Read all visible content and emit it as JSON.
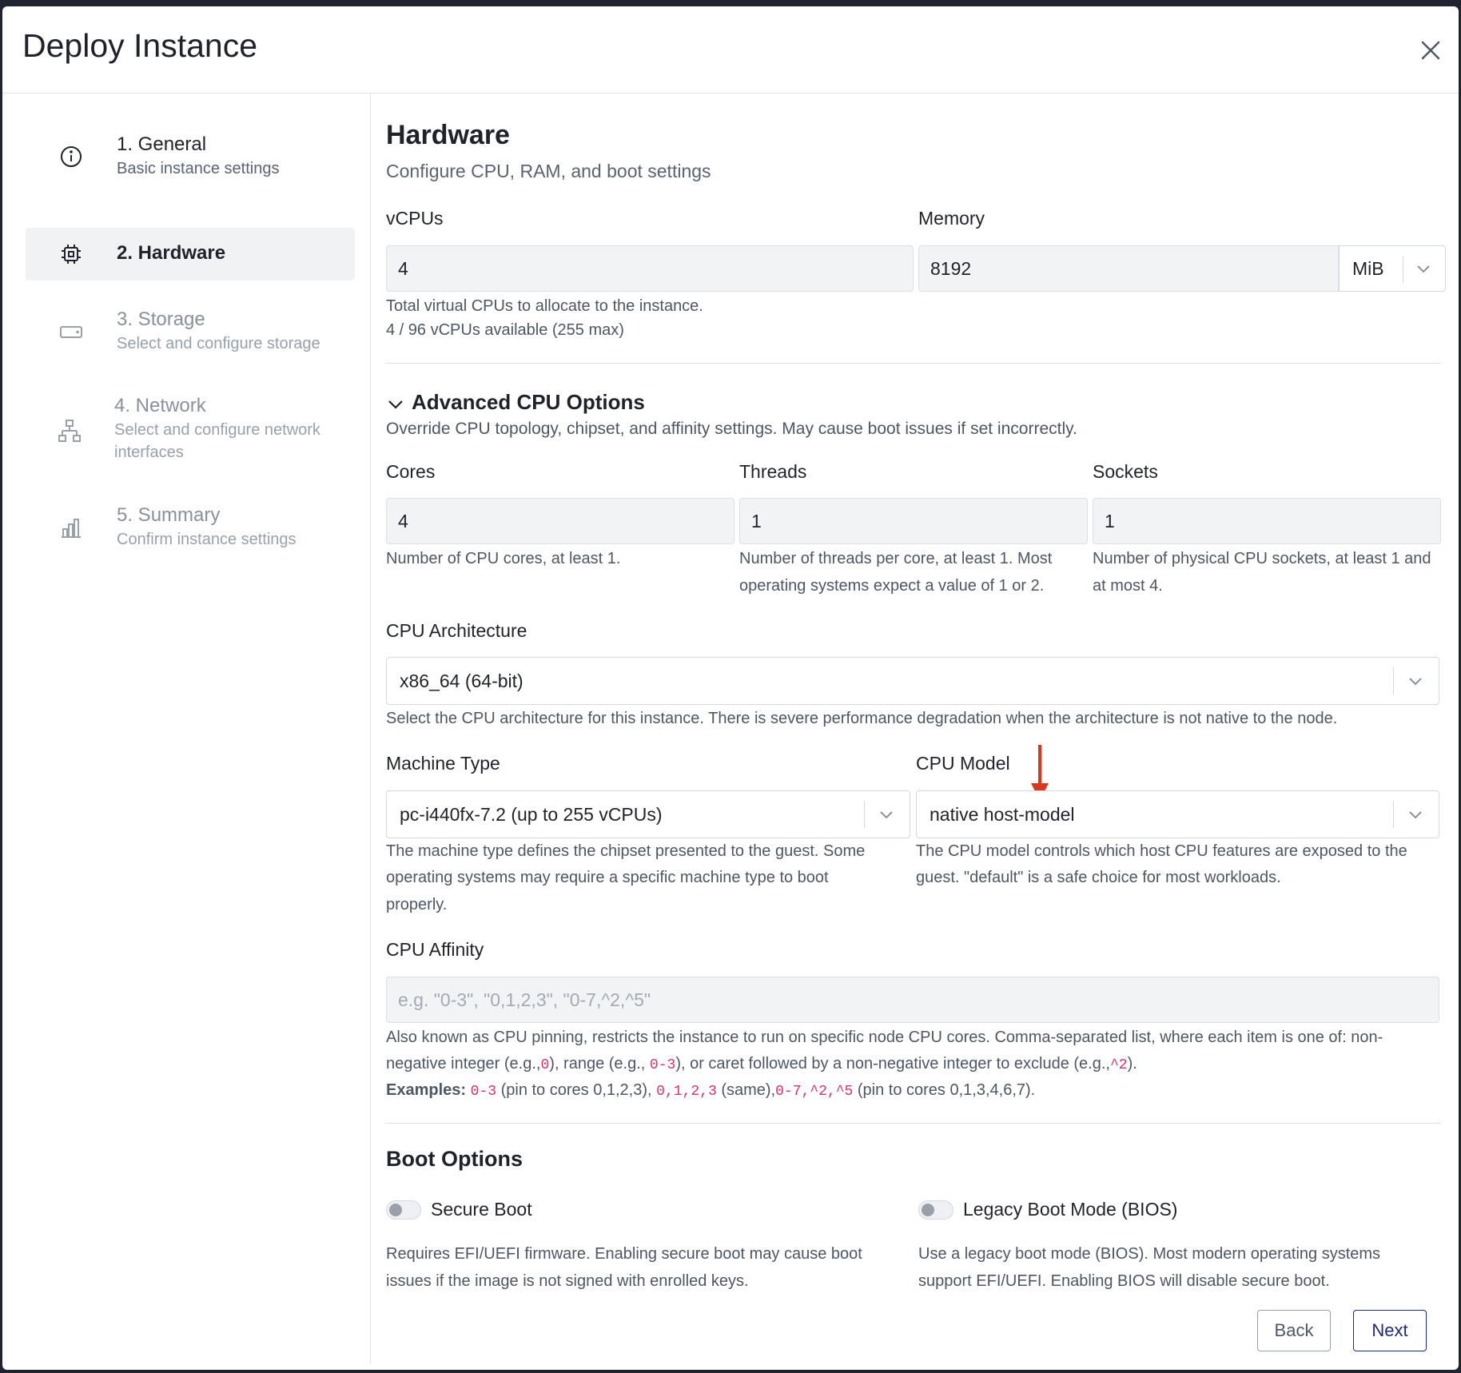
{
  "dialog": {
    "title": "Deploy Instance"
  },
  "steps": [
    {
      "title": "1. General",
      "subtitle": "Basic instance settings",
      "icon": "info-icon"
    },
    {
      "title": "2. Hardware",
      "subtitle": "",
      "icon": "cpu-chip-icon"
    },
    {
      "title": "3. Storage",
      "subtitle": "Select and configure storage",
      "icon": "hard-drive-icon"
    },
    {
      "title": "4. Network",
      "subtitle_line1": "Select and configure network",
      "subtitle_line2": "interfaces",
      "icon": "network-icon"
    },
    {
      "title": "5. Summary",
      "subtitle": "Confirm instance settings",
      "icon": "bar-chart-icon"
    }
  ],
  "hardware": {
    "title": "Hardware",
    "subtitle": "Configure CPU, RAM, and boot settings",
    "vcpus": {
      "label": "vCPUs",
      "value": "4",
      "help1": "Total virtual CPUs to allocate to the instance.",
      "help2": "4 / 96 vCPUs available (255 max)"
    },
    "memory": {
      "label": "Memory",
      "value": "8192",
      "unit": "MiB"
    }
  },
  "advanced": {
    "title": "Advanced CPU Options",
    "subtitle": "Override CPU topology, chipset, and affinity settings. May cause boot issues if set incorrectly.",
    "cores": {
      "label": "Cores",
      "value": "4",
      "help": "Number of CPU cores, at least 1."
    },
    "threads": {
      "label": "Threads",
      "value": "1",
      "help_line1": "Number of threads per core, at least 1. Most",
      "help_line2": "operating systems expect a value of 1 or 2."
    },
    "sockets": {
      "label": "Sockets",
      "value": "1",
      "help_line1": "Number of physical CPU sockets, at least 1 and",
      "help_line2": "at most 4."
    },
    "arch": {
      "label": "CPU Architecture",
      "value": "x86_64 (64-bit)",
      "help": "Select the CPU architecture for this instance. There is severe performance degradation when the architecture is not native to the node."
    },
    "machine": {
      "label": "Machine Type",
      "value": "pc-i440fx-7.2 (up to 255 vCPUs)",
      "help_line1": "The machine type defines the chipset presented to the guest. Some",
      "help_line2": "operating systems may require a specific machine type to boot",
      "help_line3": "properly."
    },
    "cpu_model": {
      "label": "CPU Model",
      "value": "native host-model",
      "help_line1": "The CPU model controls which host CPU features are exposed to the",
      "help_line2": "guest. \"default\" is a safe choice for most workloads."
    },
    "affinity": {
      "label": "CPU Affinity",
      "placeholder": "e.g. \"0-3\", \"0,1,2,3\", \"0-7,^2,^5\"",
      "help_line1": "Also known as CPU pinning, restricts the instance to run on specific node CPU cores. Comma-separated list, where each item is one of: non-",
      "help_p1": "negative integer (e.g.,",
      "code1": "0",
      "help_p2": "), range (e.g., ",
      "code2": "0-3",
      "help_p3": "), or caret followed by a non-negative integer to exclude (e.g.,",
      "code3": "^2",
      "help_p4": ").",
      "examples_label": "Examples:",
      "ex_code1": "0-3",
      "ex_t1": " (pin to cores 0,1,2,3), ",
      "ex_code2": "0,1,2,3",
      "ex_t2": " (same),",
      "ex_code3": "0-7,^2,^5",
      "ex_t3": " (pin to cores 0,1,3,4,6,7)."
    }
  },
  "boot": {
    "title": "Boot Options",
    "secure": {
      "label": "Secure Boot",
      "enabled": false,
      "help_line1": "Requires EFI/UEFI firmware. Enabling secure boot may cause boot",
      "help_line2": "issues if the image is not signed with enrolled keys."
    },
    "legacy": {
      "label": "Legacy Boot Mode (BIOS)",
      "enabled": false,
      "help_line1": "Use a legacy boot mode (BIOS). Most modern operating systems",
      "help_line2": "support EFI/UEFI. Enabling BIOS will disable secure boot."
    }
  },
  "footer": {
    "back": "Back",
    "next": "Next"
  },
  "colors": {
    "accent": "#1e2a7a",
    "annotation_arrow": "#d9381e",
    "code": "#d6336c"
  }
}
